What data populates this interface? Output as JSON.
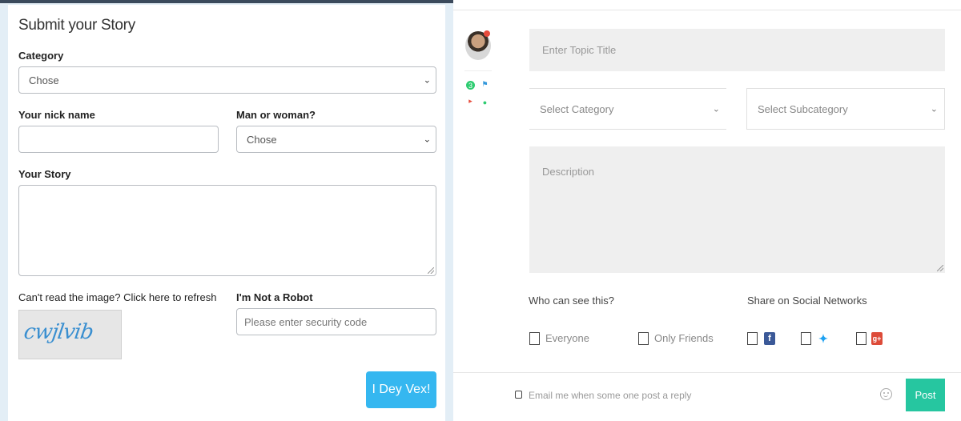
{
  "story_form": {
    "title": "Submit your Story",
    "category_label": "Category",
    "category_value": "Chose",
    "nickname_label": "Your nick name",
    "nickname_value": "",
    "gender_label": "Man or woman?",
    "gender_value": "Chose",
    "story_label": "Your Story",
    "story_value": "",
    "captcha_hint": "Can't read the image? Click here to refresh",
    "captcha_text": "cwjlvib",
    "robot_label": "I'm Not a Robot",
    "security_placeholder": "Please enter security code",
    "submit_label": "I Dey Vex!",
    "submit_color": "#35b7f0"
  },
  "topic_form": {
    "title_placeholder": "Enter Topic Title",
    "category_value": "Select Category",
    "subcategory_value": "Select Subcategory",
    "description_placeholder": "Description",
    "visibility_label": "Who can see this?",
    "visibility_options": [
      "Everyone",
      "Only Friends"
    ],
    "share_label": "Share on Social Networks",
    "social_icons": [
      "facebook-icon",
      "twitter-icon",
      "google-plus-icon"
    ],
    "email_label": "Email me when some one post a reply",
    "post_label": "Post",
    "post_color": "#26c6a0",
    "sidebar_icons": [
      "avatar",
      "notification-dot",
      "badge-icon",
      "flag-icon",
      "tag-icon",
      "pin-icon"
    ]
  }
}
